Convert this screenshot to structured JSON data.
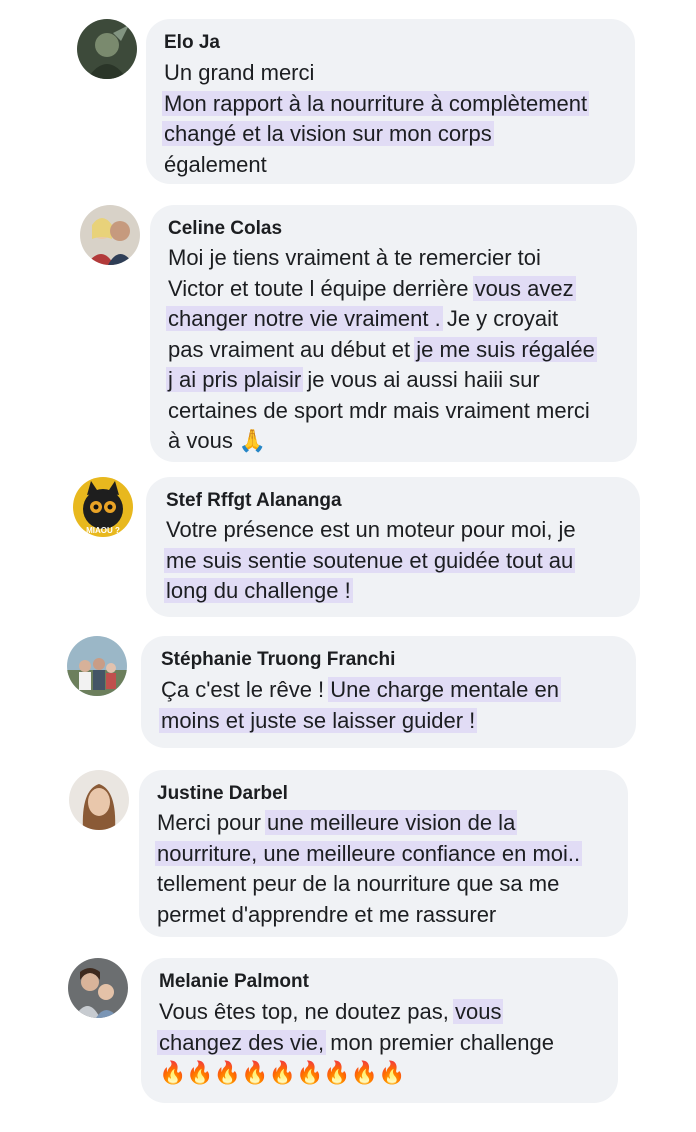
{
  "comments": [
    {
      "author": "Elo Ja",
      "lines": [
        [
          {
            "t": "Un grand merci"
          }
        ],
        [
          {
            "t": "Mon rapport à la nourriture à complètement",
            "hl": true
          }
        ],
        [
          {
            "t": "changé et la vision sur mon corps",
            "hl": true
          }
        ],
        [
          {
            "t": "également"
          }
        ]
      ]
    },
    {
      "author": "Celine Colas",
      "lines": [
        [
          {
            "t": "Moi je tiens vraiment à te remercier toi"
          }
        ],
        [
          {
            "t": "Victor et toute l équipe derrière "
          },
          {
            "t": "vous avez",
            "hl": true
          }
        ],
        [
          {
            "t": "changer notre vie vraiment .",
            "hl": true
          },
          {
            "t": " Je y croyait"
          }
        ],
        [
          {
            "t": "pas vraiment au début et "
          },
          {
            "t": "je me suis régalée",
            "hl": true
          }
        ],
        [
          {
            "t": "j ai pris plaisir",
            "hl": true
          },
          {
            "t": " je vous ai aussi haiii sur"
          }
        ],
        [
          {
            "t": "certaines de sport mdr mais vraiment merci"
          }
        ],
        [
          {
            "t": "à vous 🙏"
          }
        ]
      ]
    },
    {
      "author": "Stef Rffgt Alananga",
      "avatar_caption": "MIAOU ?",
      "lines": [
        [
          {
            "t": "Votre présence est un moteur pour moi, je"
          }
        ],
        [
          {
            "t": "me suis sentie soutenue et guidée tout au",
            "hl": true
          }
        ],
        [
          {
            "t": "long du challenge !",
            "hl": true
          }
        ]
      ]
    },
    {
      "author": "Stéphanie Truong Franchi",
      "lines": [
        [
          {
            "t": "Ça c'est le rêve ! "
          },
          {
            "t": "Une charge mentale en",
            "hl": true
          }
        ],
        [
          {
            "t": "moins et juste se laisser guider !",
            "hl": true
          }
        ]
      ]
    },
    {
      "author": "Justine Darbel",
      "lines": [
        [
          {
            "t": "Merci pour "
          },
          {
            "t": "une meilleure vision de la",
            "hl": true
          }
        ],
        [
          {
            "t": "nourriture, une meilleure confiance en moi..",
            "hl": true
          }
        ],
        [
          {
            "t": "tellement peur de la nourriture que sa me"
          }
        ],
        [
          {
            "t": "permet d'apprendre et me rassurer"
          }
        ]
      ]
    },
    {
      "author": "Melanie Palmont",
      "lines": [
        [
          {
            "t": "Vous êtes top, ne doutez pas, "
          },
          {
            "t": "vous",
            "hl": true
          }
        ],
        [
          {
            "t": "changez des vie,",
            "hl": true
          },
          {
            "t": " mon premier challenge"
          }
        ],
        [
          {
            "t": "🔥🔥🔥🔥🔥🔥🔥🔥🔥"
          }
        ]
      ]
    }
  ]
}
